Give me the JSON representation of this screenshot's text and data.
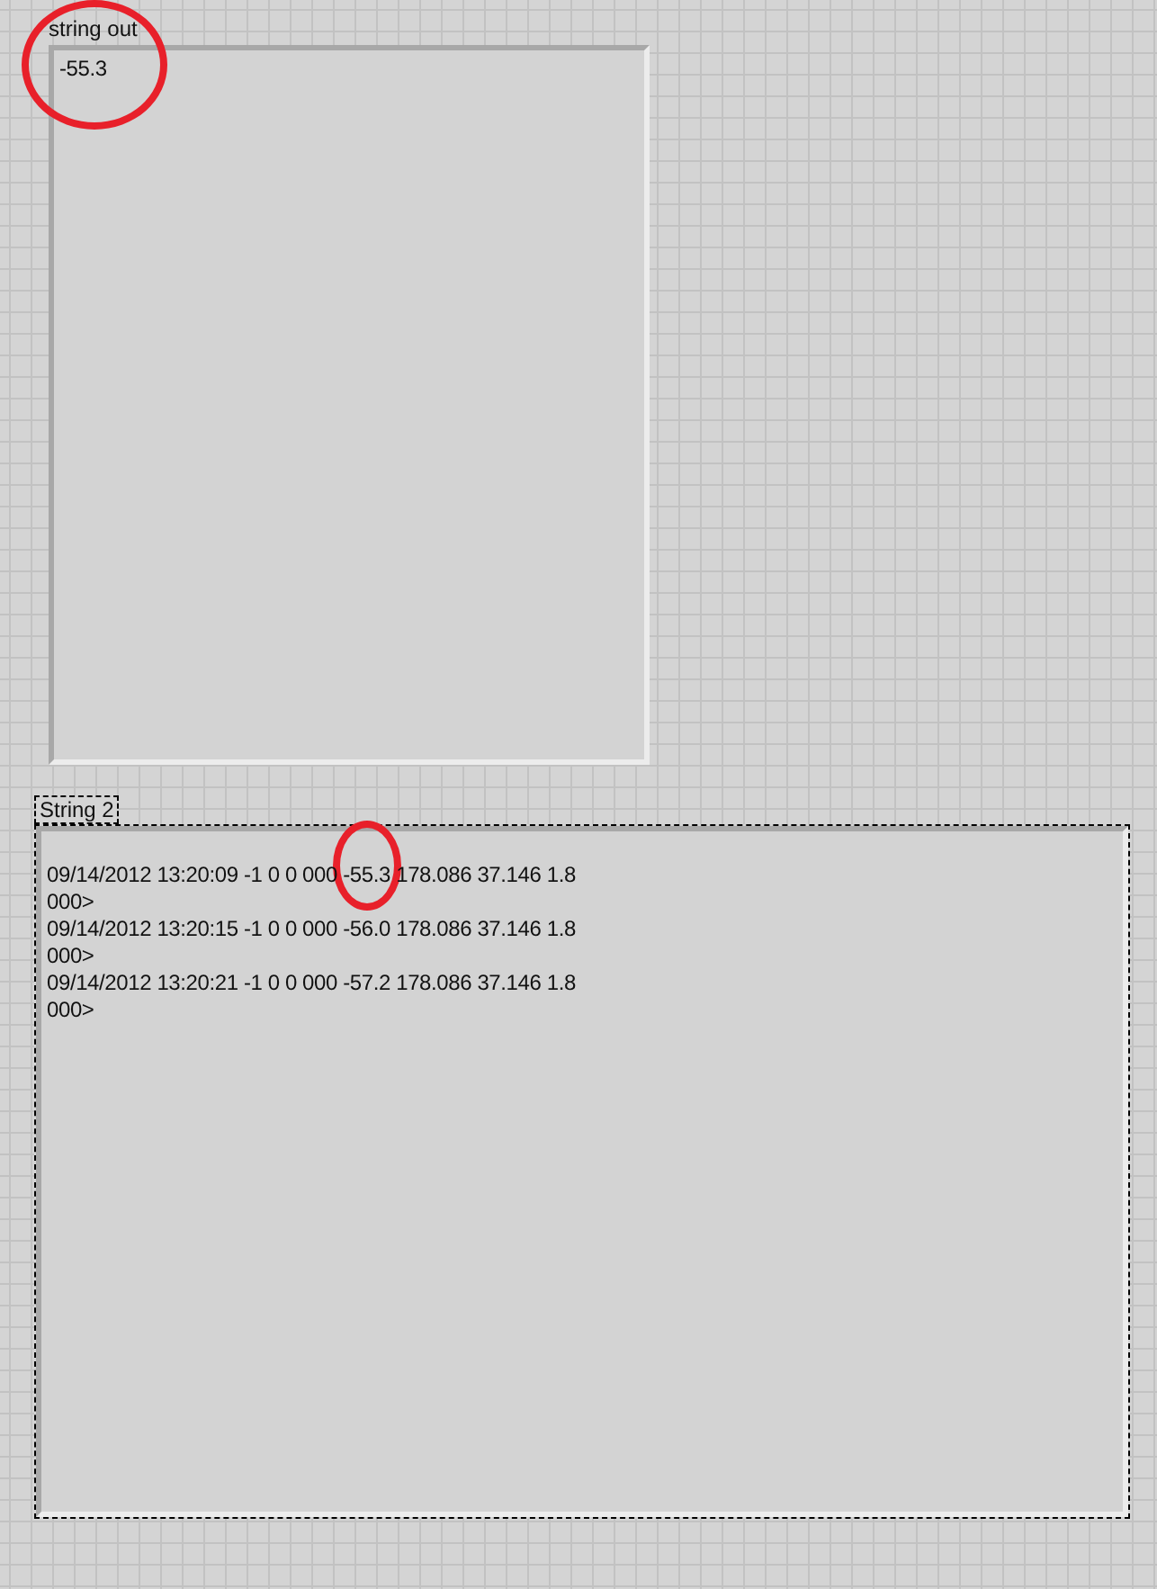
{
  "indicators": [
    {
      "label": "string out",
      "selected": false,
      "lines": [
        "-55.3"
      ]
    },
    {
      "label": "String 2",
      "selected": true,
      "lines": [
        "09/14/2012 13:20:09 -1 0 0 000 -55.3 178.086 37.146 1.8",
        "000>",
        "09/14/2012 13:20:15 -1 0 0 000 -56.0 178.086 37.146 1.8",
        "000>",
        "09/14/2012 13:20:21 -1 0 0 000 -57.2 178.086 37.146 1.8",
        "000>"
      ]
    }
  ]
}
